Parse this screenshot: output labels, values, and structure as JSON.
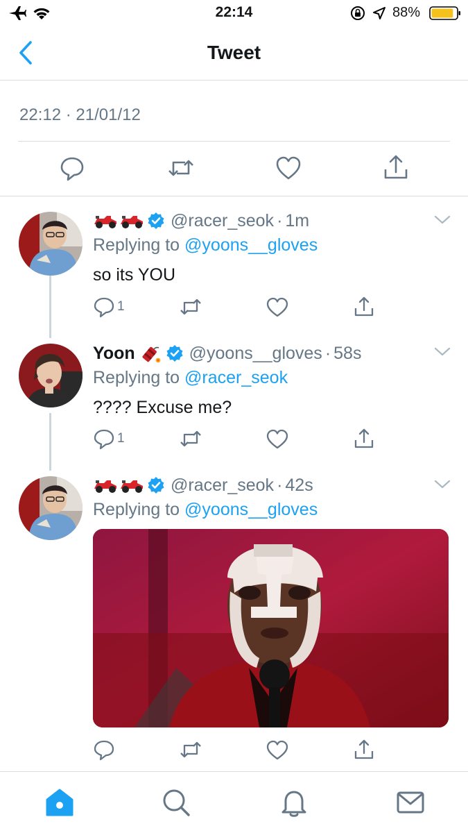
{
  "status_bar": {
    "time": "22:14",
    "battery_percent": "88%",
    "battery_level": 0.88,
    "battery_color": "#f5c21d"
  },
  "nav": {
    "title": "Tweet",
    "back_icon": "chevron-left-icon"
  },
  "main_tweet": {
    "timestamp": "22:12 · 21/01/12"
  },
  "replies": [
    {
      "name": "",
      "name_emoji": "🏎️🏎️",
      "verified": true,
      "handle": "@racer_seok",
      "time": "1m",
      "replying_label": "Replying to",
      "replying_to": "@yoons__gloves",
      "text": "so its YOU",
      "reply_count": "1"
    },
    {
      "name": "Yoon",
      "name_emoji": "🧨",
      "verified": true,
      "handle": "@yoons__gloves",
      "time": "58s",
      "replying_label": "Replying to",
      "replying_to": "@racer_seok",
      "text": "???? Excuse me?",
      "reply_count": "1"
    },
    {
      "name": "",
      "name_emoji": "🏎️🏎️",
      "verified": true,
      "handle": "@racer_seok",
      "time": "42s",
      "replying_label": "Replying to",
      "replying_to": "@yoons__gloves",
      "has_media": true
    }
  ],
  "colors": {
    "accent": "#1da1f2",
    "secondary_text": "#657786",
    "divider": "#d8dde2"
  },
  "tab_bar": {
    "items": [
      "home-icon",
      "search-icon",
      "notifications-icon",
      "messages-icon"
    ],
    "active": "home-icon"
  }
}
